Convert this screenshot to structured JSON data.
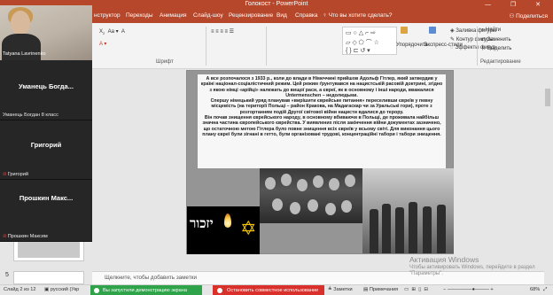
{
  "window": {
    "title": "Голокост - PowerPoint",
    "controls": "— ❐ ✕"
  },
  "tabs": [
    {
      "label": "нструктор"
    },
    {
      "label": "Переходы"
    },
    {
      "label": "Анимация"
    },
    {
      "label": "Слайд-шоу"
    },
    {
      "label": "Рецензирование"
    },
    {
      "label": "Вид"
    },
    {
      "label": "Справка"
    },
    {
      "label": "Что вы хотите сделать?"
    }
  ],
  "share_label": "Поделиться",
  "ribbon": {
    "font_group": "Шрифт",
    "arrange": "Упорядочить",
    "quick_styles": "Экспресс-стили",
    "fill": "Заливка фигуры",
    "outline": "Контур фигуры",
    "effects": "Эффекты фигур",
    "find": "Найти",
    "replace": "Заменить",
    "select": "Выделить",
    "editing_group": "Редактирование"
  },
  "call": {
    "self": {
      "name": "Tatyana Lavrinenko"
    },
    "tiles": [
      {
        "name": "Уманець Богда...",
        "caption": "Уманець Богдан 8 класс"
      },
      {
        "name": "Григорий",
        "caption": "Григорий"
      },
      {
        "name": "Прошкин Макс...",
        "caption": "Прошкин Максим"
      }
    ]
  },
  "thumbnails": [
    {
      "number": "5"
    },
    {
      "number": "5"
    }
  ],
  "slide": {
    "paragraphs": [
      "А все розпочалося з 1933 р., коли до влади в Німеччині прийшов Адольф Гітлер, який затвердив у країні націонал-соціалістичний режим. Цей режим ґрунтувався на нацистській расовій доктрині, згідно з якою німці «арійці» належать до вищої раси, а євреї, як в основному і інші народи, вважалися Untermenschen – недолюдьми.",
      "Спершу німецький уряд планував «вирішити єврейське питання» переселивши євреїв у певну місцевість (на території Польщі – район Кракова, на Мадагаскар чи за Уральські гори), проте з розгортанням подій Другої світової війни нацисти вдалися до терору.",
      "Він почав знищення єврейського народу, в основному вбиваючи в Польщі, де проживала найбільш значна частина європейського єврейства. У виявлених після закінчення війни документах зазначено, що остаточною метою Гітлера було повне знищення всіх євреїв у всьому світі. Для виконання цього плану євреї були зігнані в гетто, були організовані трудові, концентраційні табори і табори знищення."
    ],
    "candle_text": "יזכור"
  },
  "notes_placeholder": "Щелкните, чтобы добавить заметки",
  "watermark": {
    "line1": "Активация Windows",
    "line2": "Чтобы активировать Windows, перейдите в раздел \"Параметры\"."
  },
  "status": {
    "slide_counter": "Слайд 2 из 12",
    "language": "русский (Укр",
    "sharing_notice": "Вы запустили демонстрацию экрана",
    "stop_sharing": "Остановить совместное использование",
    "notes_button": "Заметки",
    "comments_button": "Примечания",
    "zoom": "68%"
  },
  "colors": {
    "accent": "#b7472a",
    "sharing_green": "#2fa34a",
    "stop_red": "#d9302b"
  }
}
